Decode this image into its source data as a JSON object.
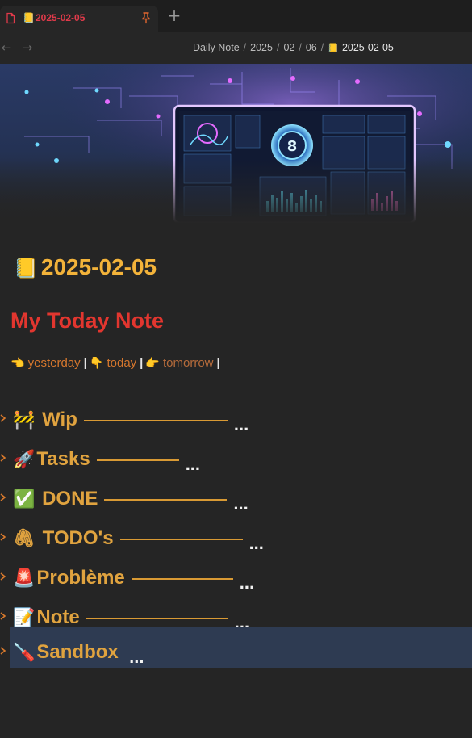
{
  "tab": {
    "title": "2025-02-05",
    "note_icon": "📒",
    "new_tab_label": "+"
  },
  "nav": {
    "back": "←",
    "forward": "→",
    "breadcrumb": [
      "Daily Note",
      "2025",
      "02",
      "06"
    ],
    "separator": "/",
    "current_icon": "📒",
    "current": "2025-02-05"
  },
  "note": {
    "title_icon": "📒",
    "title": "2025-02-05",
    "heading": "My Today Note",
    "day_nav": {
      "yesterday_icon": "👈",
      "yesterday": "yesterday",
      "today_icon": "👇",
      "today": "today",
      "tomorrow_icon": "👉",
      "tomorrow": "tomorrow",
      "separator": "|"
    }
  },
  "sections": [
    {
      "icon": "🚧",
      "label": "Wip",
      "ellipsis": "..."
    },
    {
      "icon": "🚀",
      "label": "Tasks",
      "ellipsis": "..."
    },
    {
      "icon": "✅",
      "label": "DONE",
      "ellipsis": "..."
    },
    {
      "icon": "🖇",
      "label": "TODO's",
      "ellipsis": "..."
    },
    {
      "icon": "🚨",
      "label": "Problème",
      "ellipsis": "..."
    },
    {
      "icon": "📝",
      "label": "Note",
      "ellipsis": "..."
    },
    {
      "icon": "🪛",
      "label": "Sandbox",
      "ellipsis": "..."
    }
  ],
  "colors": {
    "accent_tab": "#e03a4a",
    "title": "#f3b33a",
    "heading": "#e2362f",
    "section": "#e0a33f",
    "link": "#d6772d",
    "selected_row": "#2e3b52"
  }
}
